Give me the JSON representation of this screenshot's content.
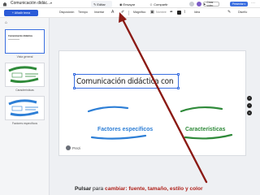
{
  "topbar": {
    "title": "Comunicación didác...",
    "tabs": [
      {
        "label": "Editar",
        "icon": "pencil-icon"
      },
      {
        "label": "Ensayar",
        "icon": "rehearse-icon"
      },
      {
        "label": "Compartir",
        "icon": "person-icon"
      }
    ],
    "video_label": "Crear vídeo",
    "present_label": "Presentar ▾"
  },
  "toolbar": {
    "add_topic_label": "+ Añadir tema",
    "items": [
      "Disposición",
      "Tiempo",
      "Insertar",
      "Mágnifico",
      "Nombre",
      "Idea",
      "Diseño"
    ]
  },
  "left_panel": {
    "thumbs": [
      {
        "title": "Comunicación didáctica",
        "caption": "Vista general"
      },
      {
        "caption": "Características"
      },
      {
        "caption": "Factores específicos"
      }
    ]
  },
  "slide": {
    "title": "Comunicación didáctica con",
    "subtopic_left": "Factores específicos",
    "subtopic_right": "Características",
    "logo_text": "Prezi"
  },
  "annotation": {
    "part1": "Pulsar",
    "part2": " para ",
    "part3": "cambiar: fuente, tamaño, estilo y color"
  },
  "colors": {
    "accent_blue": "#3b6fe0",
    "subtopic_blue": "#2e7fd6",
    "subtopic_green": "#2f8a3a",
    "arrow_red": "#8b1a14"
  }
}
